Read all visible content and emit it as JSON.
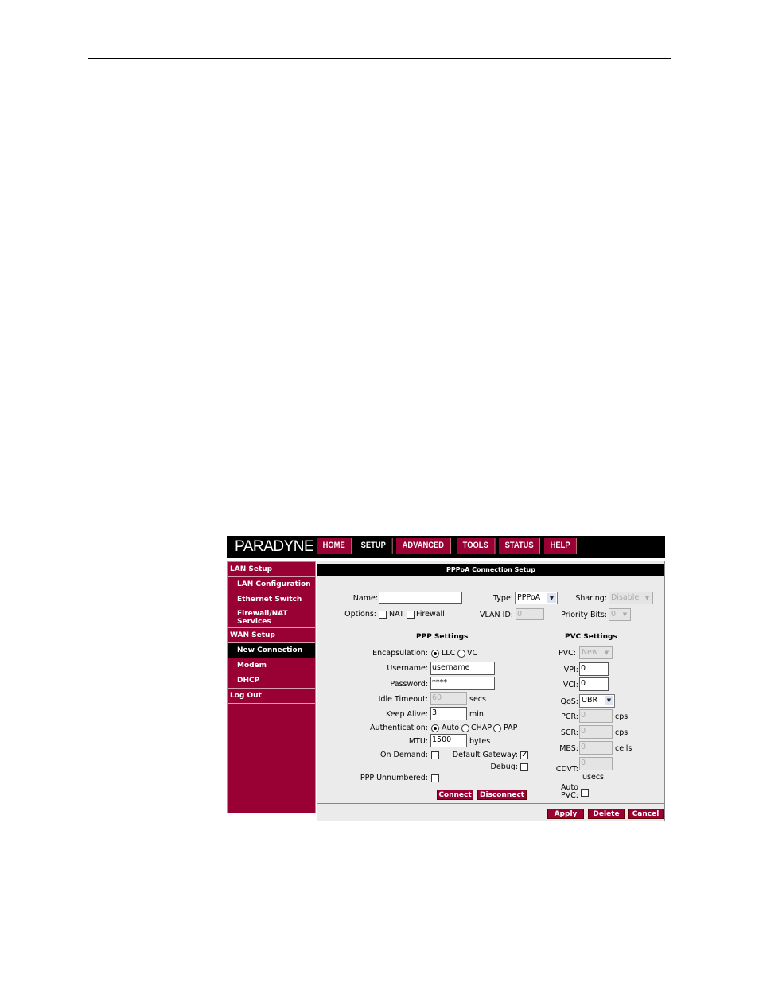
{
  "logo": "PARADYNE",
  "nav": [
    "HOME",
    "SETUP",
    "ADVANCED",
    "TOOLS",
    "STATUS",
    "HELP"
  ],
  "nav_active": "SETUP",
  "sidebar": {
    "lan_setup": "LAN Setup",
    "lan_configuration": "LAN Configuration",
    "ethernet_switch": "Ethernet Switch",
    "firewall_nat_1": "Firewall/NAT",
    "firewall_nat_2": "Services",
    "wan_setup": "WAN Setup",
    "new_connection": "New Connection",
    "modem": "Modem",
    "dhcp": "DHCP",
    "log_out": "Log Out"
  },
  "panel_title": "PPPoA Connection Setup",
  "form": {
    "name_label": "Name:",
    "name_value": "",
    "type_label": "Type:",
    "type_value": "PPPoA",
    "sharing_label": "Sharing:",
    "sharing_value": "Disable",
    "options_label": "Options:",
    "nat_label": "NAT",
    "firewall_label": "Firewall",
    "vlan_label": "VLAN ID:",
    "vlan_value": "0",
    "priority_label": "Priority Bits:",
    "priority_value": "0"
  },
  "ppp": {
    "title": "PPP Settings",
    "encapsulation_label": "Encapsulation:",
    "llc": "LLC",
    "vc": "VC",
    "username_label": "Username:",
    "username_value": "username",
    "password_label": "Password:",
    "password_value": "****",
    "idle_timeout_label": "Idle Timeout:",
    "idle_timeout_value": "60",
    "idle_timeout_unit": "secs",
    "keep_alive_label": "Keep Alive:",
    "keep_alive_value": "3",
    "keep_alive_unit": "min",
    "auth_label": "Authentication:",
    "auth_auto": "Auto",
    "auth_chap": "CHAP",
    "auth_pap": "PAP",
    "mtu_label": "MTU:",
    "mtu_value": "1500",
    "mtu_unit": "bytes",
    "on_demand_label": "On Demand:",
    "default_gateway_label": "Default Gateway:",
    "debug_label": "Debug:",
    "ppp_unnumbered_label": "PPP Unnumbered:",
    "connect": "Connect",
    "disconnect": "Disconnect"
  },
  "pvc": {
    "title": "PVC Settings",
    "pvc_label": "PVC:",
    "pvc_value": "New",
    "vpi_label": "VPI:",
    "vpi_value": "0",
    "vci_label": "VCI:",
    "vci_value": "0",
    "qos_label": "QoS:",
    "qos_value": "UBR",
    "pcr_label": "PCR:",
    "pcr_value": "0",
    "pcr_unit": "cps",
    "scr_label": "SCR:",
    "scr_value": "0",
    "scr_unit": "cps",
    "mbs_label": "MBS:",
    "mbs_value": "0",
    "mbs_unit": "cells",
    "cdvt_label": "CDVT:",
    "cdvt_value": "0",
    "cdvt_unit": "usecs",
    "auto_pvc_1": "Auto",
    "auto_pvc_2": "PVC:"
  },
  "footer": {
    "apply": "Apply",
    "delete": "Delete",
    "cancel": "Cancel"
  },
  "icons": {
    "dropdown": "chevron-down-icon",
    "checkmark": "checkmark-icon"
  },
  "colors": {
    "brand": "#990033",
    "nav_bg": "#000000",
    "panel_bg": "#ebebeb"
  }
}
